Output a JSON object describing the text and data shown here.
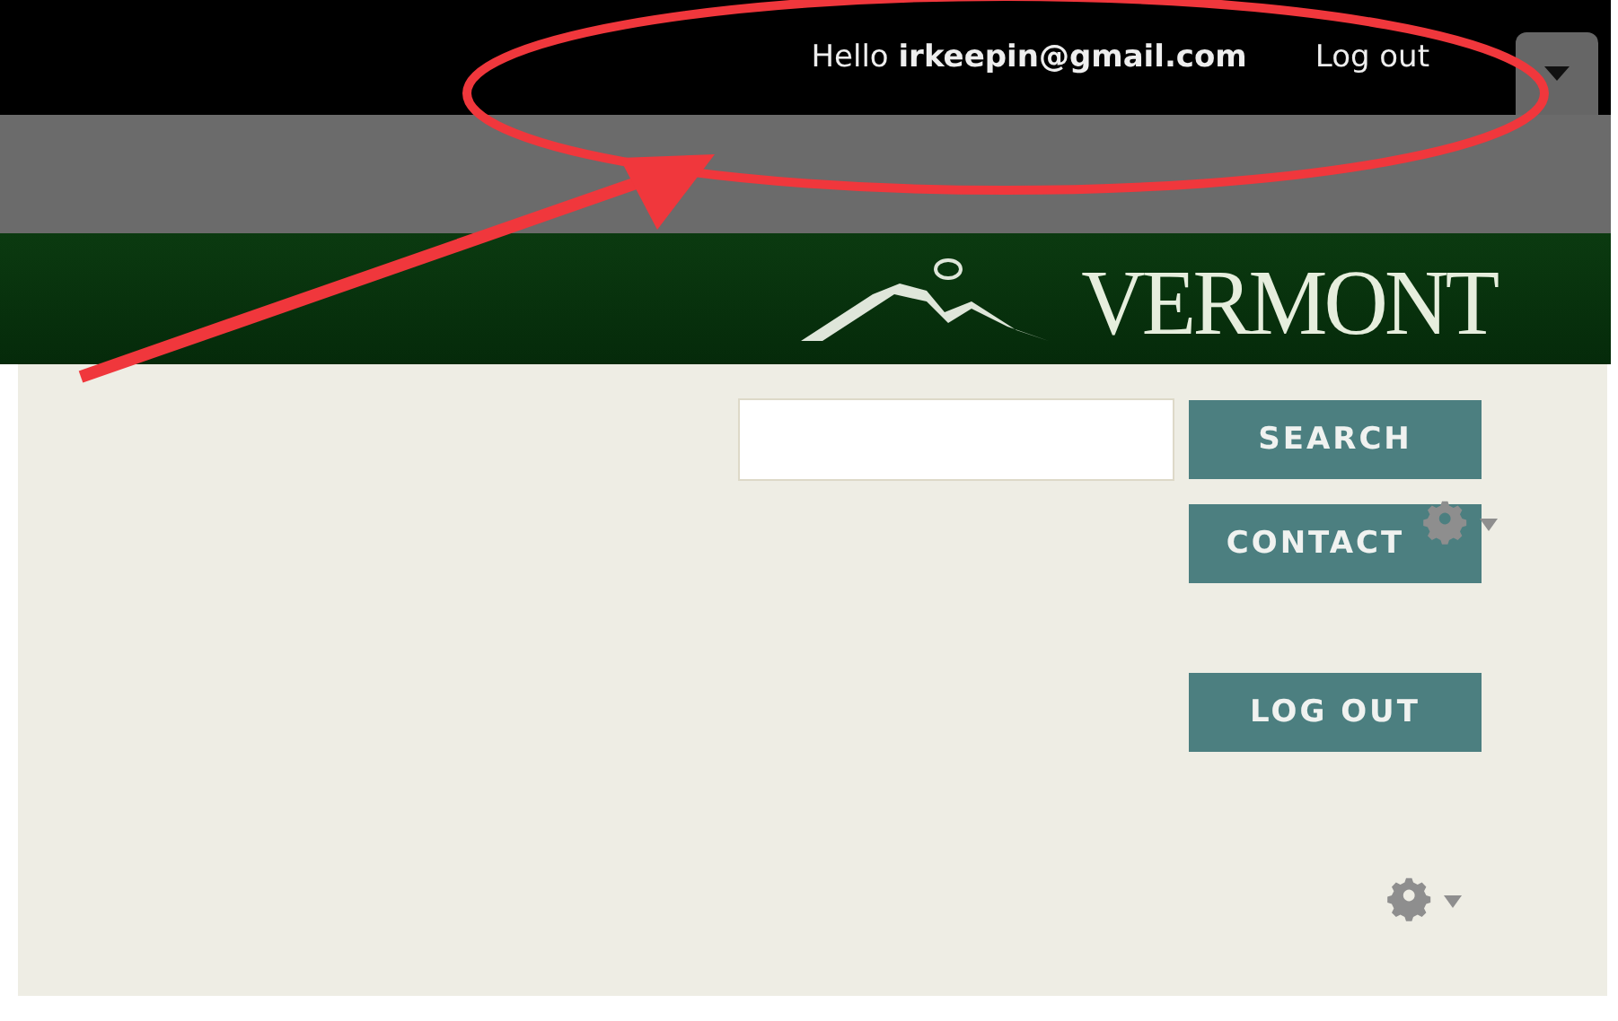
{
  "top_bar": {
    "greeting": "Hello",
    "user": "irkeepin@gmail.com",
    "logout_link": "Log out"
  },
  "header": {
    "logo_text": "VERMONT"
  },
  "search": {
    "button": "SEARCH"
  },
  "buttons": [
    {
      "label": "CONTACT",
      "kind": "contact"
    },
    {
      "label": "LOG OUT",
      "kind": "logout"
    }
  ]
}
